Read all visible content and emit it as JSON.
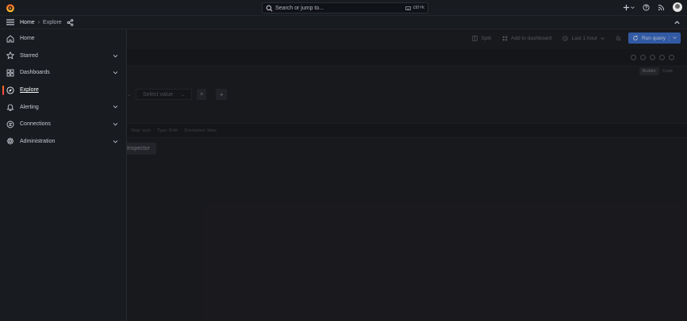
{
  "topbar": {
    "search_placeholder": "Search or jump to...",
    "shortcut": "ctrl+k"
  },
  "breadcrumb": {
    "home": "Home",
    "separator": "›",
    "current": "Explore"
  },
  "sidebar": {
    "items": [
      {
        "label": "Home",
        "icon": "home-icon",
        "expandable": false,
        "active": false
      },
      {
        "label": "Starred",
        "icon": "star-icon",
        "expandable": true,
        "active": false
      },
      {
        "label": "Dashboards",
        "icon": "dashboards-icon",
        "expandable": true,
        "active": false
      },
      {
        "label": "Explore",
        "icon": "compass-icon",
        "expandable": false,
        "active": true
      },
      {
        "label": "Alerting",
        "icon": "bell-icon",
        "expandable": true,
        "active": false
      },
      {
        "label": "Connections",
        "icon": "connections-icon",
        "expandable": true,
        "active": false
      },
      {
        "label": "Administration",
        "icon": "cog-icon",
        "expandable": true,
        "active": false
      }
    ]
  },
  "toolbar": {
    "split_label": "Split",
    "add_dashboard_label": "Add to dashboard",
    "time_range_label": "Last 1 hour",
    "run_query_label": "Run query"
  },
  "query": {
    "mode_builder": "Builder",
    "mode_code": "Code",
    "select_value_placeholder": "Select value",
    "remove_label": "×",
    "add_label": "+",
    "options": [
      "Step: auto",
      "Type: Both",
      "Exemplars: false"
    ],
    "inspector_label": "Inspector"
  },
  "colors": {
    "accent_gradient_start": "#ff7b22",
    "accent_gradient_end": "#f53e4c",
    "primary_button": "#3d6ec8",
    "background": "#111217",
    "panel": "#181b1f"
  }
}
